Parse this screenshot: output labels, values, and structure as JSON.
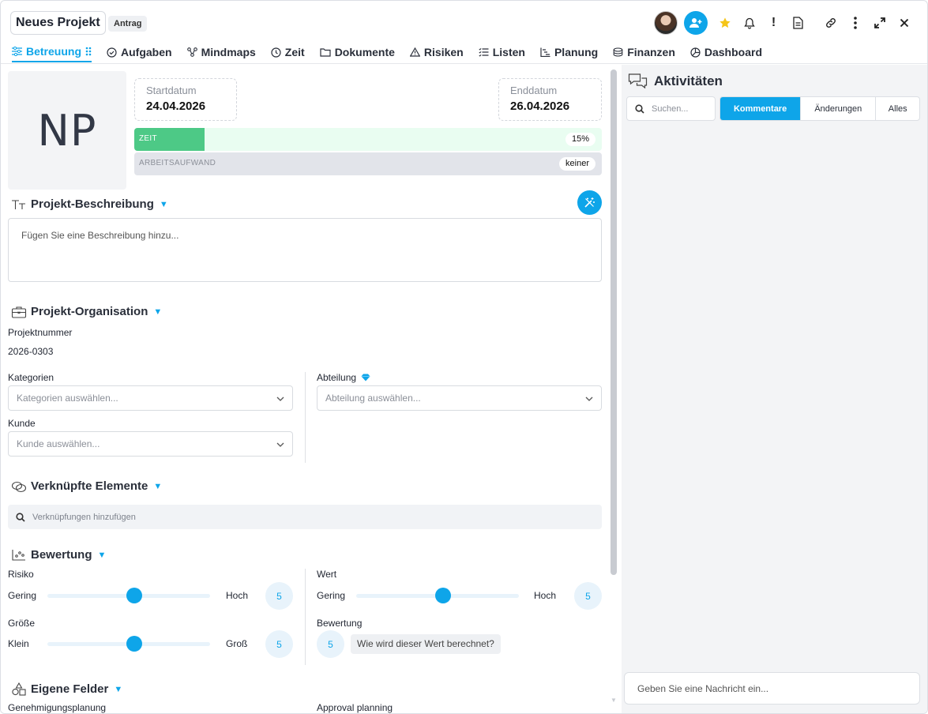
{
  "header": {
    "project_title": "Neues Projekt",
    "status_chip": "Antrag",
    "icons": [
      "avatar",
      "add-user-icon",
      "star-icon",
      "bell-icon",
      "exclamation-icon",
      "document-icon",
      "link-icon",
      "more-vertical-icon",
      "expand-icon",
      "close-icon"
    ]
  },
  "tabs": [
    {
      "label": "Betreuung",
      "icon": "sliders-icon",
      "active": true
    },
    {
      "label": "Aufgaben",
      "icon": "check-circle-icon"
    },
    {
      "label": "Mindmaps",
      "icon": "mindmap-icon"
    },
    {
      "label": "Zeit",
      "icon": "clock-icon"
    },
    {
      "label": "Dokumente",
      "icon": "folder-icon"
    },
    {
      "label": "Risiken",
      "icon": "warning-icon"
    },
    {
      "label": "Listen",
      "icon": "list-icon"
    },
    {
      "label": "Planung",
      "icon": "gantt-icon"
    },
    {
      "label": "Finanzen",
      "icon": "coins-icon"
    },
    {
      "label": "Dashboard",
      "icon": "dashboard-icon"
    }
  ],
  "overview": {
    "initials": "NP",
    "start_label": "Startdatum",
    "start_value": "24.04.2026",
    "end_label": "Enddatum",
    "end_value": "26.04.2026",
    "zeit_label": "ZEIT",
    "zeit_percent": "15%",
    "zeit_fraction": 0.15,
    "arbeit_label": "ARBEITSAUFWAND",
    "arbeit_value": "keiner"
  },
  "description": {
    "title": "Projekt-Beschreibung",
    "placeholder": "Fügen Sie eine Beschreibung hinzu..."
  },
  "organisation": {
    "title": "Projekt-Organisation",
    "projektnummer_label": "Projektnummer",
    "projektnummer_value": "2026-0303",
    "kategorien_label": "Kategorien",
    "kategorien_placeholder": "Kategorien auswählen...",
    "kunde_label": "Kunde",
    "kunde_placeholder": "Kunde auswählen...",
    "abteilung_label": "Abteilung",
    "abteilung_placeholder": "Abteilung auswählen..."
  },
  "linked": {
    "title": "Verknüpfte Elemente",
    "placeholder": "Verknüpfungen hinzufügen"
  },
  "rating": {
    "title": "Bewertung",
    "risiko": {
      "label": "Risiko",
      "min": "Gering",
      "max": "Hoch",
      "value": "5"
    },
    "groesse": {
      "label": "Größe",
      "min": "Klein",
      "max": "Groß",
      "value": "5"
    },
    "wert": {
      "label": "Wert",
      "min": "Gering",
      "max": "Hoch",
      "value": "5"
    },
    "bewertung": {
      "label": "Bewertung",
      "value": "5",
      "hint": "Wie wird dieser Wert berechnet?"
    }
  },
  "custom_fields": {
    "title": "Eigene Felder",
    "left_label": "Genehmigungsplanung",
    "right_label": "Approval planning"
  },
  "activities": {
    "title": "Aktivitäten",
    "search_placeholder": "Suchen...",
    "filters": [
      "Kommentare",
      "Änderungen",
      "Alles"
    ],
    "message_placeholder": "Geben Sie eine Nachricht ein..."
  },
  "colors": {
    "accent": "#0ea5e9",
    "zeit_fill": "#4dc986",
    "zeit_track": "#e9fdf1"
  }
}
